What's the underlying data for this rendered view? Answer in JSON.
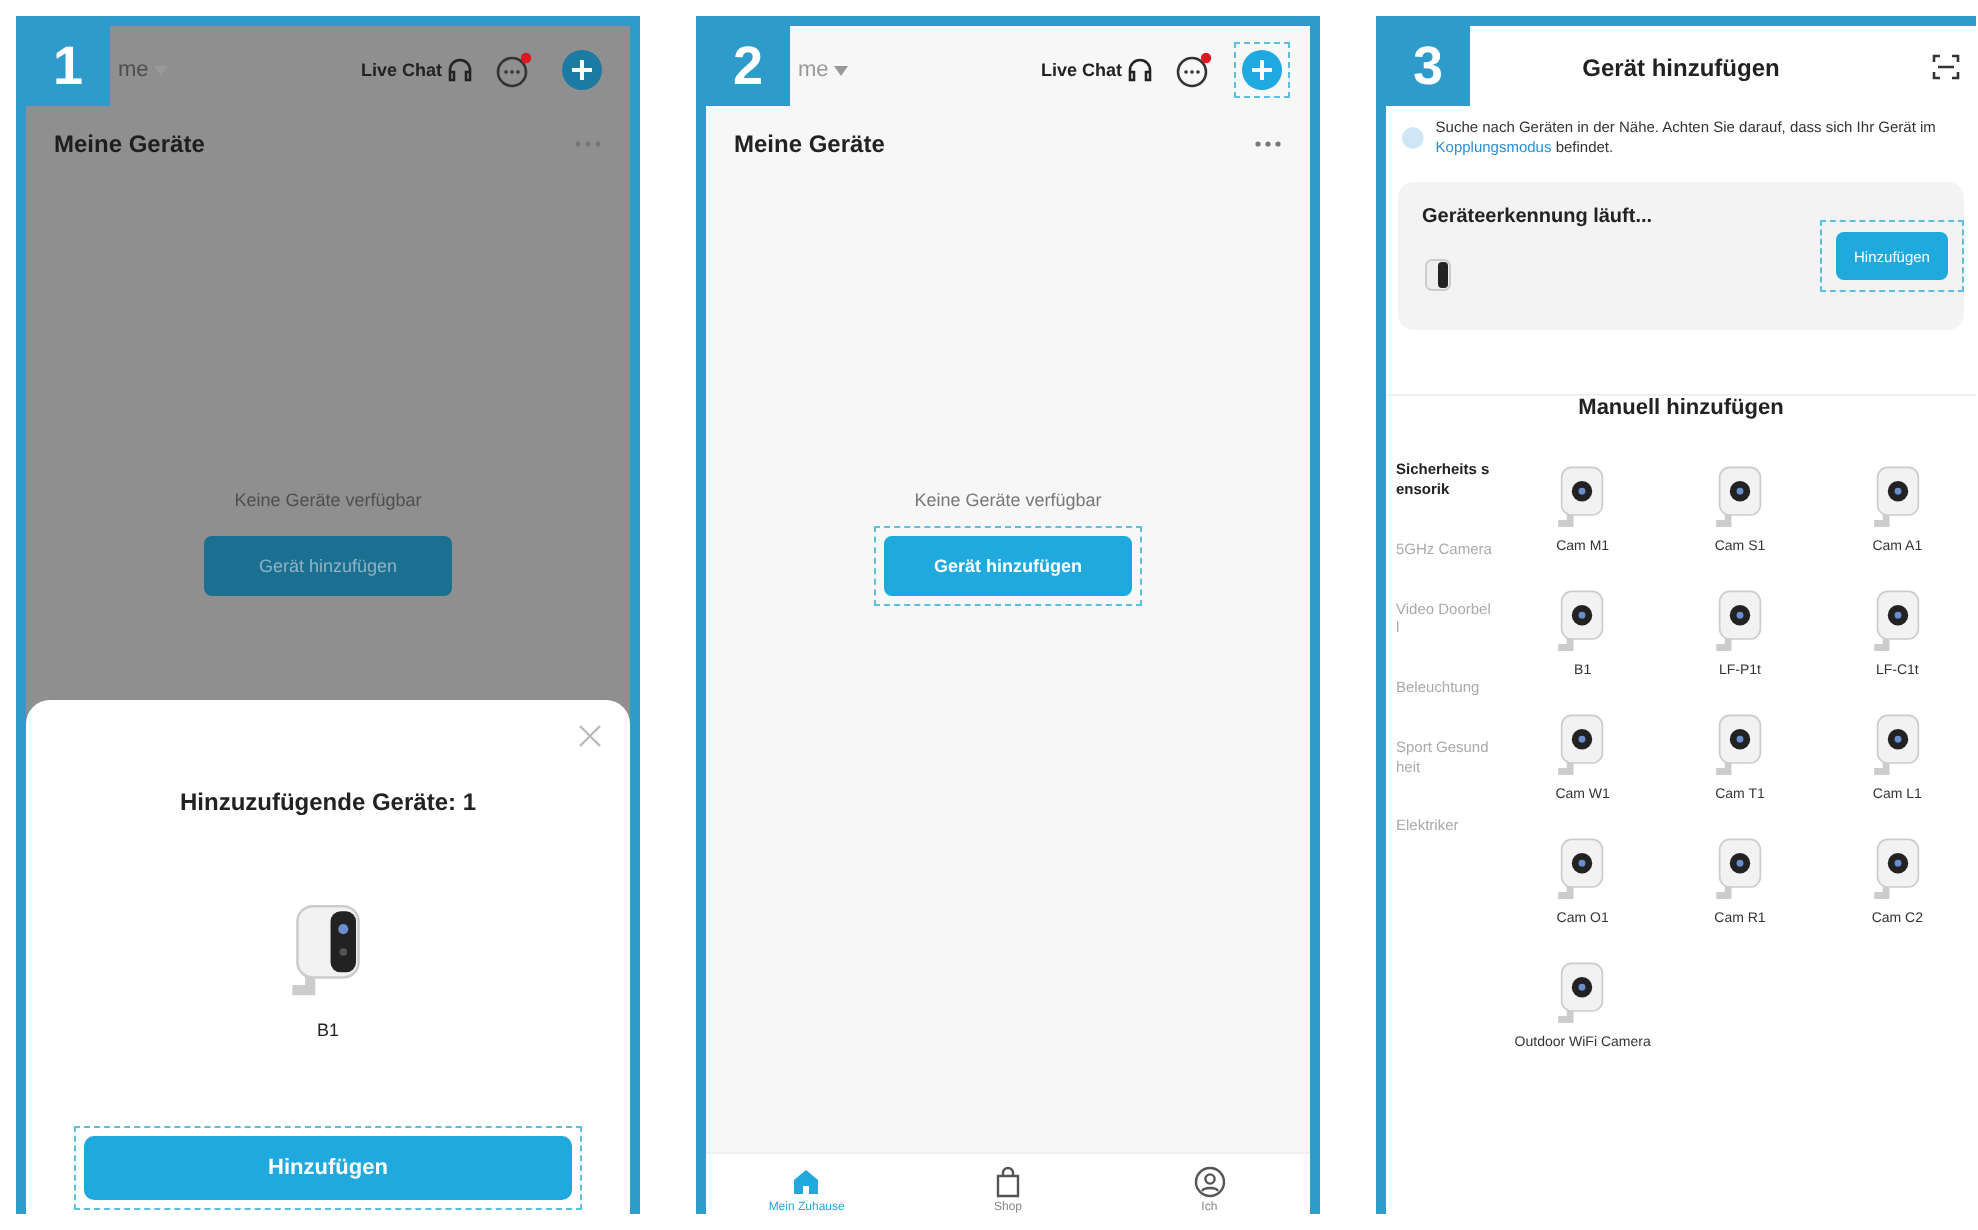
{
  "phones": [
    {
      "kind": "home",
      "step": "1",
      "dimmed": true,
      "home_label": "me",
      "live_chat": "Live Chat",
      "unread": true,
      "plus_highlighted": false,
      "title": "Meine Geräte",
      "empty_text": "Keine Geräte verfügbar",
      "add_button": {
        "label": "Gerät hinzufügen",
        "highlighted": false
      },
      "dialog": {
        "title": "Hinzuzufügende Geräte: 1",
        "device": "B1",
        "button": {
          "label": "Hinzufügen",
          "highlighted": true
        }
      }
    },
    {
      "kind": "home",
      "step": "2",
      "dimmed": false,
      "home_label": "me",
      "live_chat": "Live Chat",
      "unread": true,
      "plus_highlighted": true,
      "title": "Meine Geräte",
      "empty_text": "Keine Geräte verfügbar",
      "add_button": {
        "label": "Gerät hinzufügen",
        "highlighted": true
      },
      "nav": [
        {
          "kind": "home",
          "label": "Mein Zuhause",
          "selected": true
        },
        {
          "kind": "shop",
          "label": "Shop",
          "selected": false
        },
        {
          "kind": "profile",
          "label": "Ich",
          "selected": false
        }
      ]
    },
    {
      "kind": "add",
      "step": "3",
      "title": "Gerät hinzufügen",
      "notice": "Suche nach Geräten in der Nähe. Achten Sie darauf, dass sich Ihr Gerät im",
      "link": "Kopplungsmodus",
      "notice_end": "befindet.",
      "scan": {
        "status": "Geräteerkennung läuft...",
        "button": {
          "label": "Hinzufügen",
          "highlighted": true
        }
      },
      "manual_title": "Manuell hinzufügen",
      "categories": [
        {
          "label": "Sicherheits sensorik",
          "selected": true
        },
        {
          "label": "5GHz Camera",
          "selected": false
        },
        {
          "label": "Video Doorbell",
          "selected": false
        },
        {
          "label": "Beleuchtung",
          "selected": false
        },
        {
          "label": "Sport Gesundheit",
          "selected": false
        },
        {
          "label": "Elektriker",
          "selected": false
        }
      ],
      "products": [
        "Cam M1",
        "Cam S1",
        "Cam A1",
        "B1",
        "LF-P1t",
        "LF-C1t",
        "Cam W1",
        "Cam T1",
        "Cam L1",
        "Cam O1",
        "Cam R1",
        "Cam C2",
        "Outdoor WiFi Camera"
      ]
    }
  ]
}
